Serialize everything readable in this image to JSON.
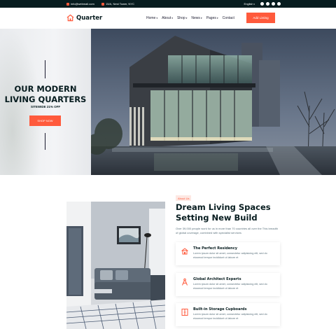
{
  "topbar": {
    "email": "info@webmail.com",
    "address": "15/A, Nest Tower, NYC",
    "language": "English",
    "socials": [
      "facebook-icon",
      "twitter-icon",
      "instagram-icon",
      "dribbble-icon"
    ]
  },
  "header": {
    "brand": "Quarter",
    "nav": [
      {
        "label": "Home",
        "has_caret": true
      },
      {
        "label": "About",
        "has_caret": true
      },
      {
        "label": "Shop",
        "has_caret": true
      },
      {
        "label": "News",
        "has_caret": true
      },
      {
        "label": "Pages",
        "has_caret": true
      },
      {
        "label": "Contact",
        "has_caret": false
      }
    ],
    "cta": "Add Listing"
  },
  "hero": {
    "title_line1": "OUR MODERN",
    "title_line2": "LIVING QUARTERS",
    "subtitle": "SITEWIDE 21% OFF",
    "button": "SHOP NOW"
  },
  "about": {
    "tag": "About Us",
    "title_line1": "Dream Living Spaces",
    "title_line2": "Setting New Build",
    "description": "Over 39,000 people work for us in more than 70 countries all over the This breadth of global coverage, combined with specialist services",
    "features": [
      {
        "title": "The Perfect Residency",
        "desc": "Lorem ipsum dolor sit amet, consectetur adipisicing elit, sed do eiusmod tempor incididunt ut labore et",
        "icon": "house-icon"
      },
      {
        "title": "Global Architect Experts",
        "desc": "Lorem ipsum dolor sit amet, consectetur adipisicing elit, sed do eiusmod tempor incididunt ut labore et",
        "icon": "compass-icon"
      },
      {
        "title": "Built-in Storage Cupboards",
        "desc": "Lorem ipsum dolor sit amet, consectetur adipisicing elit, sed do eiusmod tempor incididunt ut labore et",
        "icon": "cupboard-icon"
      }
    ]
  },
  "colors": {
    "accent": "#ff5a3c",
    "dark": "#071c1f",
    "muted": "#5c727d"
  }
}
